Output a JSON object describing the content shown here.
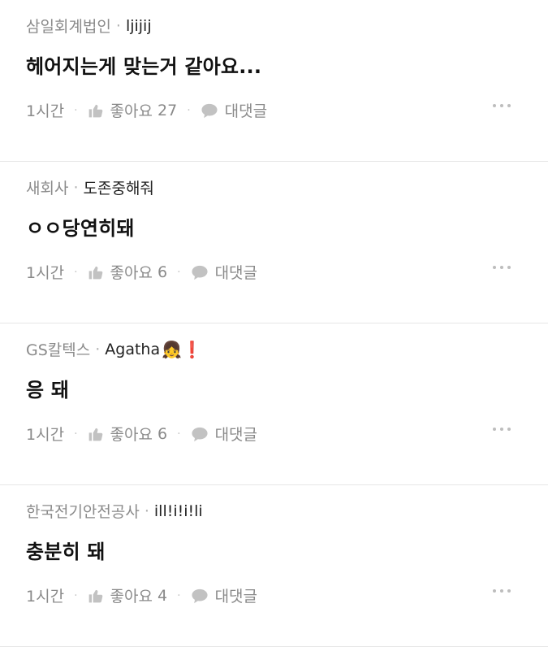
{
  "comments": [
    {
      "company": "삼일회계법인",
      "nickname": "ljijij",
      "emoji": "",
      "text": "헤어지는게 맞는거 같아요...",
      "time": "1시간",
      "like_label": "좋아요",
      "like_count": "27",
      "reply_label": "대댓글"
    },
    {
      "company": "새회사",
      "nickname": "도존중해줘",
      "emoji": "",
      "text": "ㅇㅇ당연히돼",
      "time": "1시간",
      "like_label": "좋아요",
      "like_count": "6",
      "reply_label": "대댓글"
    },
    {
      "company": "GS칼텍스",
      "nickname": "Agatha",
      "emoji": "👧❗",
      "text": "응 돼",
      "time": "1시간",
      "like_label": "좋아요",
      "like_count": "6",
      "reply_label": "대댓글"
    },
    {
      "company": "한국전기안전공사",
      "nickname": "ill!i!i!li",
      "emoji": "",
      "text": "충분히 돼",
      "time": "1시간",
      "like_label": "좋아요",
      "like_count": "4",
      "reply_label": "대댓글"
    }
  ],
  "separator": "·",
  "icons": {
    "like": "thumbs-up-icon",
    "reply": "speech-bubble-icon",
    "more": "more-dots-icon"
  },
  "colors": {
    "meta_gray": "#8a8a8a",
    "divider": "#e6e6e6",
    "icon_gray": "#c2c2c2"
  }
}
